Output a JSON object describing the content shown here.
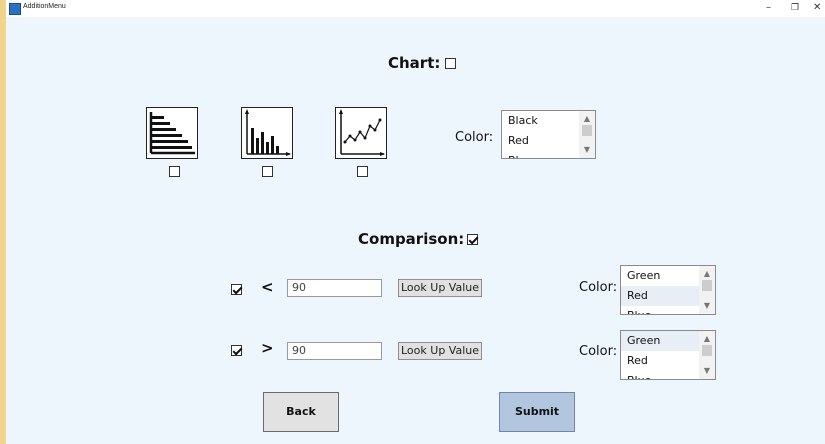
{
  "window": {
    "title": "AdditionMenu",
    "minimize_glyph": "–",
    "maximize_glyph": "❐",
    "close_glyph": "✕"
  },
  "chart_section": {
    "heading": "Chart:",
    "heading_checked": false,
    "chart_types": [
      {
        "icon": "horizontal-bar-chart-icon",
        "checked": false
      },
      {
        "icon": "vertical-bar-chart-icon",
        "checked": false
      },
      {
        "icon": "line-chart-icon",
        "checked": false
      }
    ],
    "color_label": "Color:",
    "color_options": [
      "Black",
      "Red",
      "Blue"
    ]
  },
  "comparison_section": {
    "heading": "Comparison:",
    "heading_checked": true,
    "rows": [
      {
        "checked": true,
        "operator": "<",
        "value": "90",
        "lookup_label": "Look Up Value",
        "color_label": "Color:",
        "color_options": [
          "Green",
          "Red",
          "Blue"
        ],
        "selected": "Red"
      },
      {
        "checked": true,
        "operator": ">",
        "value": "90",
        "lookup_label": "Look Up Value",
        "color_label": "Color:",
        "color_options": [
          "Green",
          "Red",
          "Blue"
        ],
        "selected": "Green"
      }
    ]
  },
  "buttons": {
    "back": "Back",
    "submit": "Submit"
  }
}
